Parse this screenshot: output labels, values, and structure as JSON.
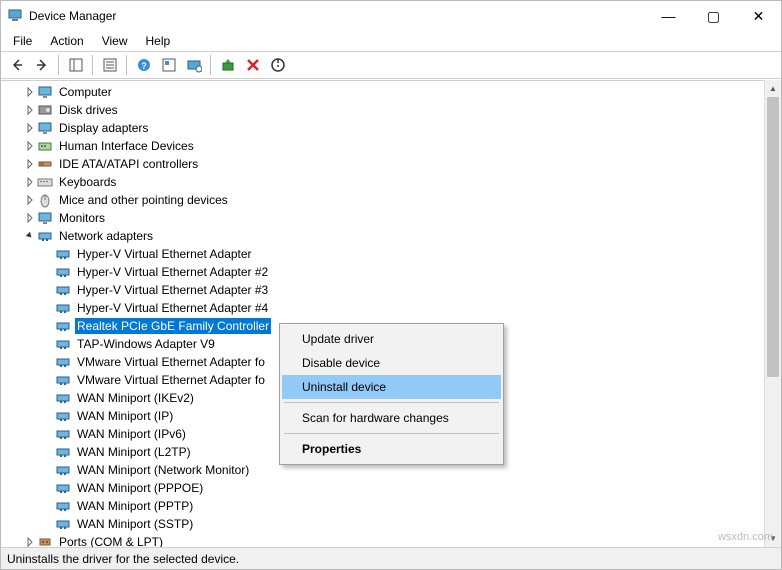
{
  "window": {
    "title": "Device Manager",
    "buttons": {
      "min": "—",
      "max": "▢",
      "close": "✕"
    }
  },
  "menubar": [
    "File",
    "Action",
    "View",
    "Help"
  ],
  "toolbar_tips": {
    "back": "Back",
    "forward": "Forward",
    "show_hide": "Show/Hide Console Tree",
    "properties": "Properties",
    "help": "Help",
    "action_center": "Action Center",
    "scan": "Scan for hardware changes",
    "update": "Update driver",
    "uninstall": "Uninstall device",
    "disable": "Disable device"
  },
  "tree": {
    "categories": [
      {
        "label": "Computer",
        "icon": "monitor",
        "expandable": true
      },
      {
        "label": "Disk drives",
        "icon": "disk",
        "expandable": true
      },
      {
        "label": "Display adapters",
        "icon": "monitor",
        "expandable": true
      },
      {
        "label": "Human Interface Devices",
        "icon": "hid",
        "expandable": true
      },
      {
        "label": "IDE ATA/ATAPI controllers",
        "icon": "ide",
        "expandable": true
      },
      {
        "label": "Keyboards",
        "icon": "keyboard",
        "expandable": true
      },
      {
        "label": "Mice and other pointing devices",
        "icon": "mouse",
        "expandable": true
      },
      {
        "label": "Monitors",
        "icon": "monitor",
        "expandable": true
      },
      {
        "label": "Network adapters",
        "icon": "network",
        "expandable": true,
        "expanded": true,
        "children": [
          {
            "label": "Hyper-V Virtual Ethernet Adapter",
            "icon": "network"
          },
          {
            "label": "Hyper-V Virtual Ethernet Adapter #2",
            "icon": "network"
          },
          {
            "label": "Hyper-V Virtual Ethernet Adapter #3",
            "icon": "network"
          },
          {
            "label": "Hyper-V Virtual Ethernet Adapter #4",
            "icon": "network"
          },
          {
            "label": "Realtek PCIe GbE Family Controller",
            "icon": "network",
            "selected": true
          },
          {
            "label": "TAP-Windows Adapter V9",
            "icon": "network"
          },
          {
            "label": "VMware Virtual Ethernet Adapter fo",
            "icon": "network"
          },
          {
            "label": "VMware Virtual Ethernet Adapter fo",
            "icon": "network"
          },
          {
            "label": "WAN Miniport (IKEv2)",
            "icon": "network"
          },
          {
            "label": "WAN Miniport (IP)",
            "icon": "network"
          },
          {
            "label": "WAN Miniport (IPv6)",
            "icon": "network"
          },
          {
            "label": "WAN Miniport (L2TP)",
            "icon": "network"
          },
          {
            "label": "WAN Miniport (Network Monitor)",
            "icon": "network"
          },
          {
            "label": "WAN Miniport (PPPOE)",
            "icon": "network"
          },
          {
            "label": "WAN Miniport (PPTP)",
            "icon": "network"
          },
          {
            "label": "WAN Miniport (SSTP)",
            "icon": "network"
          }
        ]
      },
      {
        "label": "Ports (COM & LPT)",
        "icon": "port",
        "expandable": true
      }
    ]
  },
  "context_menu": {
    "items": [
      {
        "label": "Update driver"
      },
      {
        "label": "Disable device"
      },
      {
        "label": "Uninstall device",
        "hovered": true
      },
      {
        "sep": true
      },
      {
        "label": "Scan for hardware changes"
      },
      {
        "sep": true
      },
      {
        "label": "Properties",
        "bold": true
      }
    ]
  },
  "statusbar": "Uninstalls the driver for the selected device.",
  "watermark": "wsxdn.com"
}
